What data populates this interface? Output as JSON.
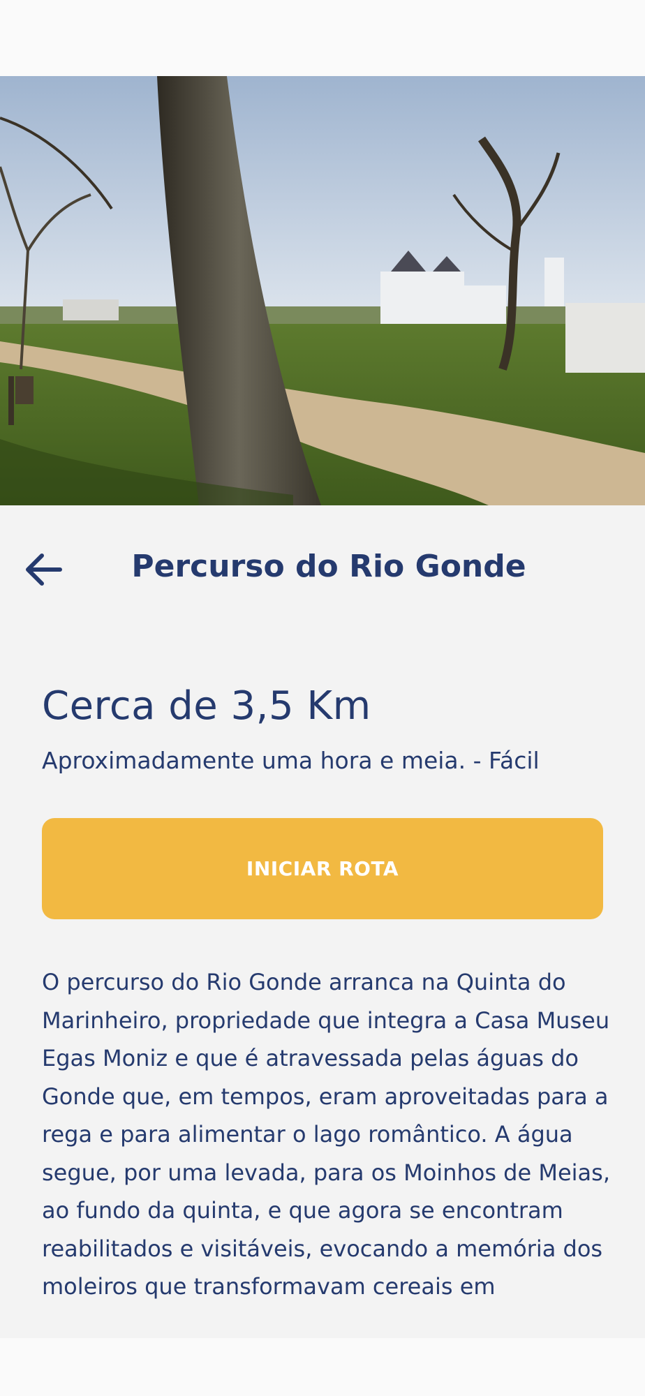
{
  "header": {
    "title": "Percurso do Rio Gonde",
    "back_icon": "arrow-left-icon"
  },
  "hero": {
    "image": "park-with-trees-and-manor-house"
  },
  "route": {
    "distance": "Cerca de 3,5 Km",
    "duration": "Aproximadamente uma hora e meia. - Fácil",
    "start_label": "INICIAR ROTA"
  },
  "description": "O percurso do Rio Gonde arranca na Quinta do Marinheiro, propriedade que integra a Casa Museu Egas Moniz e que é atravessada pelas águas do Gonde que, em tempos, eram aproveitadas para a rega e para alimentar o lago romântico. A água segue, por uma levada, para os Moinhos de Meias, ao fundo da quinta, e que agora se encontram reabilitados e visitáveis, evocando a memória dos moleiros que transformavam cereais em",
  "colors": {
    "primary_text": "#253a6e",
    "accent": "#f2b942",
    "background": "#f3f3f3"
  }
}
